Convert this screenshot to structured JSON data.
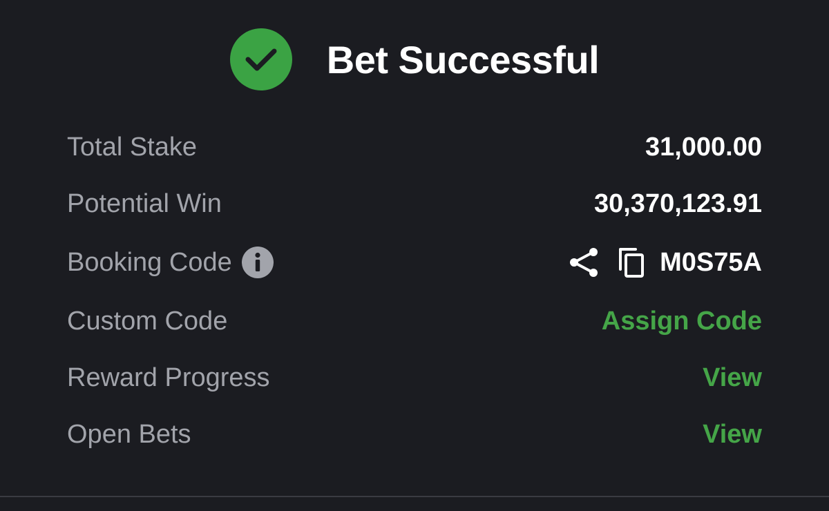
{
  "header": {
    "title": "Bet Successful",
    "status_icon": "check-circle-icon",
    "accent_color": "#3ba344"
  },
  "details": {
    "total_stake": {
      "label": "Total Stake",
      "value": "31,000.00"
    },
    "potential_win": {
      "label": "Potential Win",
      "value": "30,370,123.91"
    },
    "booking_code": {
      "label": "Booking Code",
      "value": "M0S75A",
      "icons": [
        "info-icon",
        "share-icon",
        "copy-icon"
      ]
    },
    "custom_code": {
      "label": "Custom Code",
      "action": "Assign Code"
    },
    "reward_progress": {
      "label": "Reward Progress",
      "action": "View"
    },
    "open_bets": {
      "label": "Open Bets",
      "action": "View"
    }
  },
  "colors": {
    "background": "#1b1c21",
    "label": "#a2a4ab",
    "value": "#ffffff",
    "link": "#45a548"
  }
}
